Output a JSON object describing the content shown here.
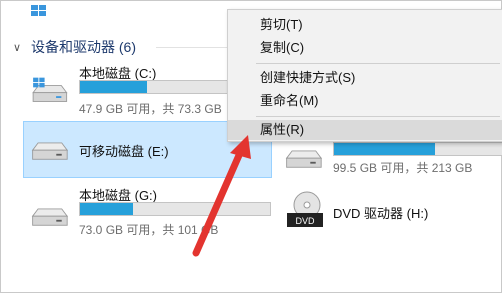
{
  "group": {
    "title": "设备和驱动器 (6)"
  },
  "drives": [
    {
      "name": "本地磁盘 (C:)",
      "usage_text": "47.9 GB 可用，共 73.3 GB",
      "used_fraction": 0.35
    },
    {
      "name": "可移动磁盘 (E:)"
    },
    {
      "name": "本地磁盘 (G:)",
      "usage_text": "73.0 GB 可用，共 101 GB",
      "used_fraction": 0.28
    },
    {
      "usage_text": "99.5 GB 可用，共 213 GB",
      "used_fraction": 0.53
    },
    {
      "name": "DVD 驱动器 (H:)",
      "icon_label": "DVD"
    }
  ],
  "context_menu": {
    "items": [
      "剪切(T)",
      "复制(C)",
      "创建快捷方式(S)",
      "重命名(M)",
      "属性(R)"
    ],
    "highlighted": "属性(R)"
  },
  "colors": {
    "accent": "#26a0da",
    "selection": "#cce8ff",
    "arrow": "#e3342f"
  }
}
